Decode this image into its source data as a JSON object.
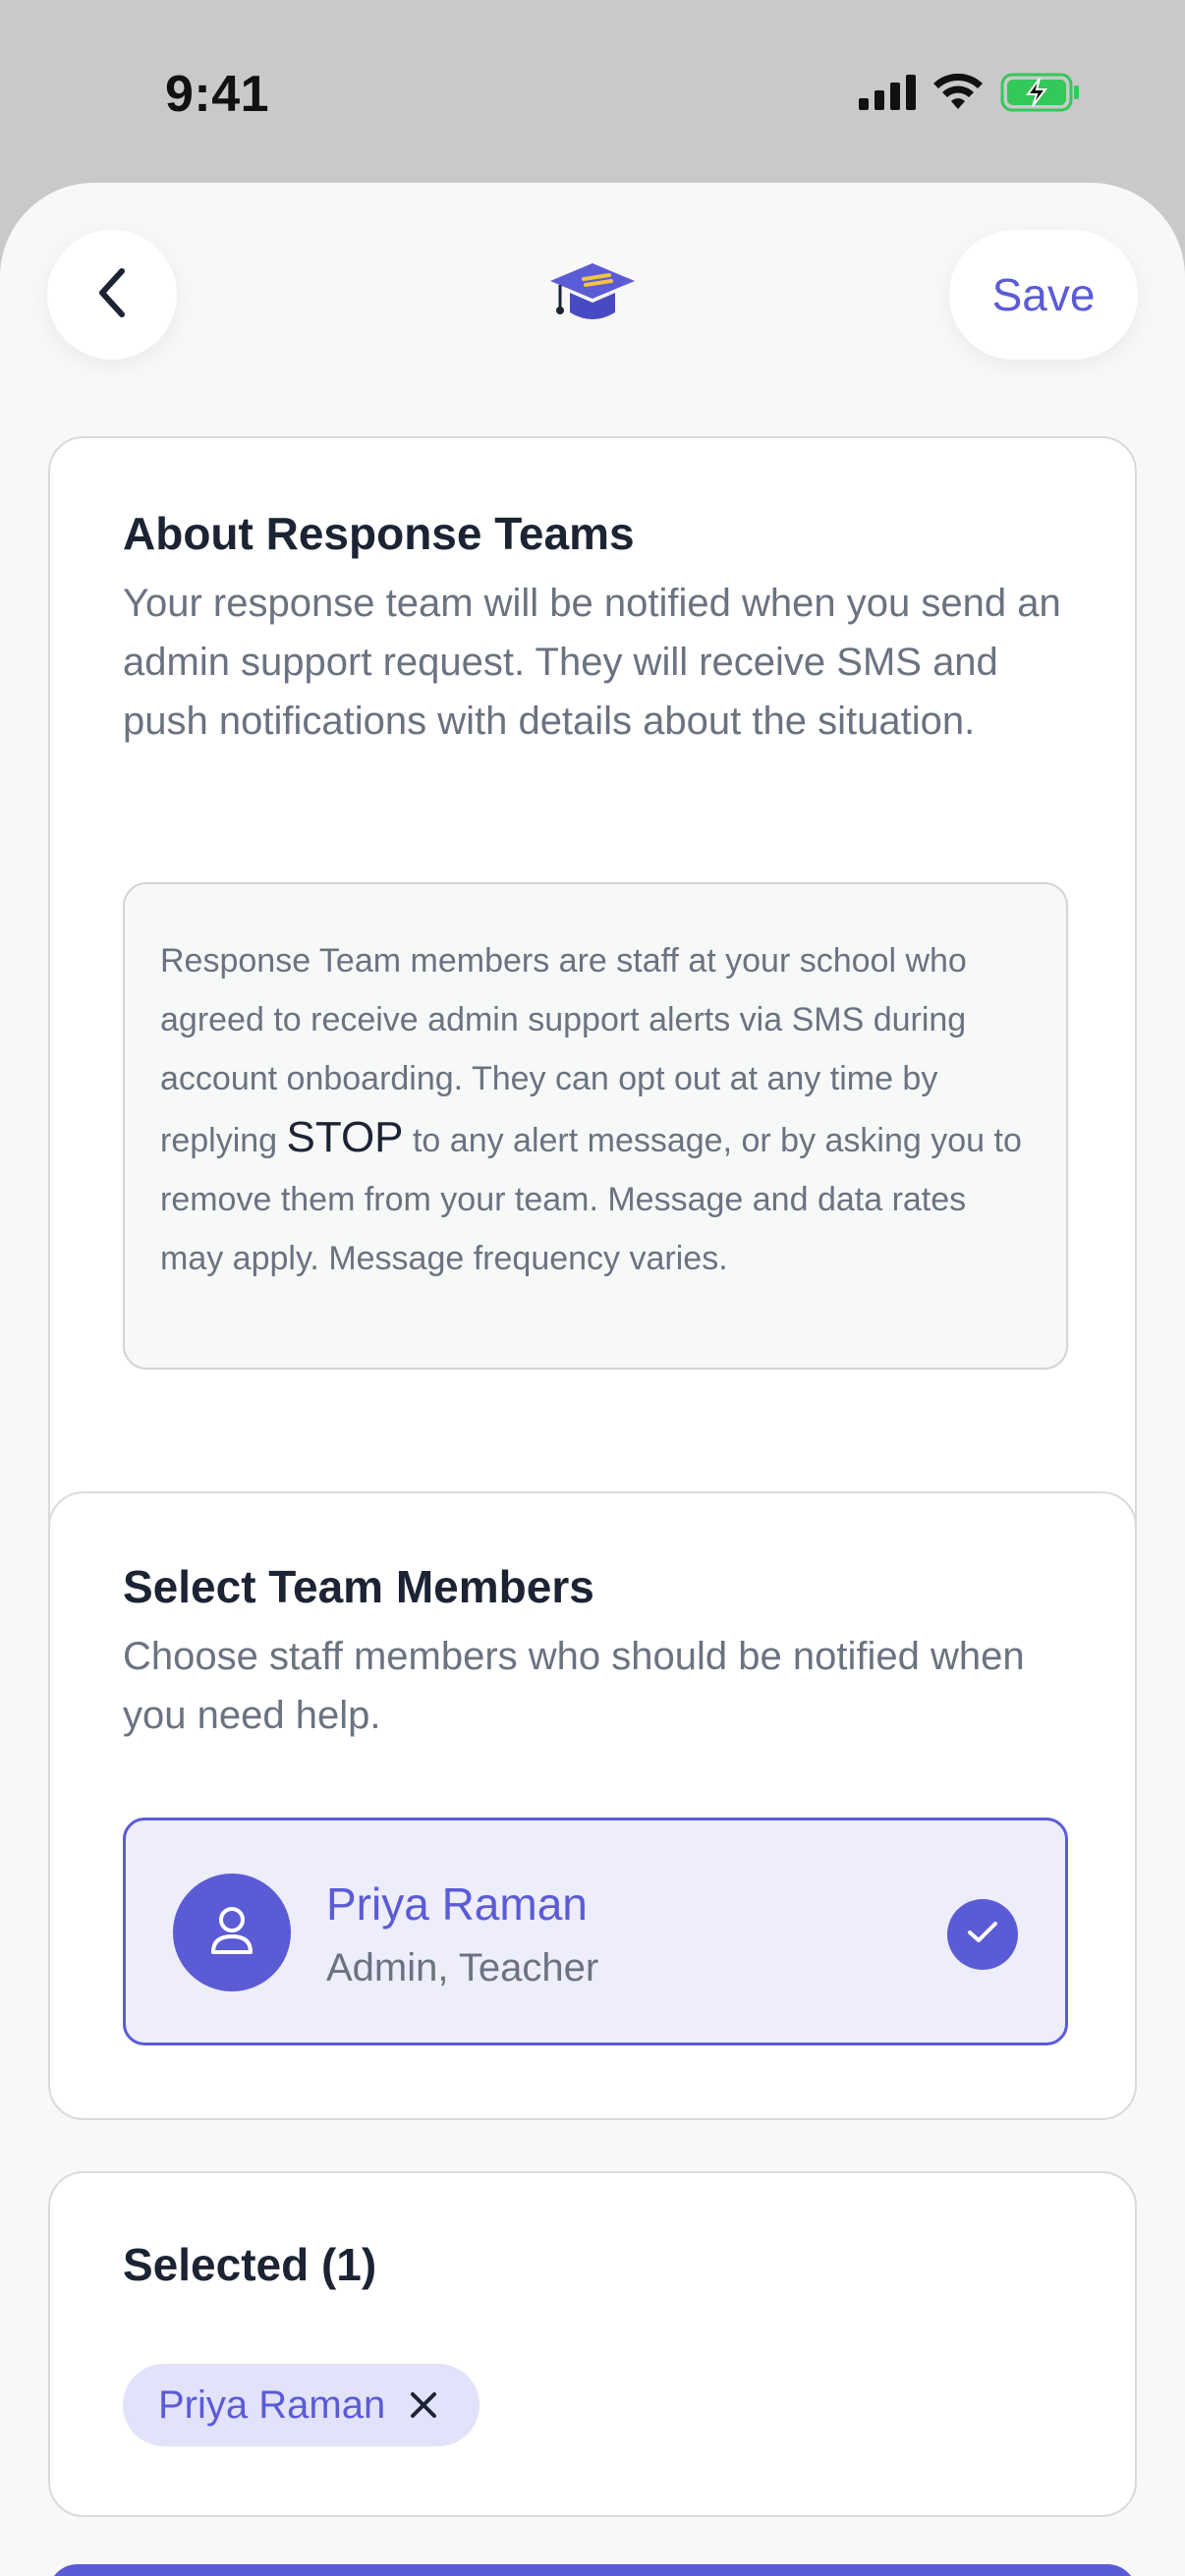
{
  "status_bar": {
    "time": "9:41"
  },
  "header": {
    "back_icon": "chevron-left-icon",
    "logo_icon": "graduation-cap-icon",
    "save_label": "Save"
  },
  "about": {
    "title": "About Response Teams",
    "description": "Your response team will be notified when you send an admin support request. They will receive SMS and push notifications with details about the situation.",
    "info_before": "Response Team members are staff at your school who agreed to receive admin support alerts via SMS during account onboarding. They can opt out at any time by replying ",
    "info_keyword": "STOP",
    "info_after": " to any alert message, or by asking you to remove them from your team. Message and data rates may apply. Message frequency varies."
  },
  "select_members": {
    "title": "Select Team Members",
    "description": "Choose staff members who should be notified when you need help.",
    "members": [
      {
        "name": "Priya Raman",
        "role": "Admin, Teacher",
        "selected": true
      }
    ]
  },
  "selected": {
    "title": "Selected (1)",
    "chips": [
      {
        "label": "Priya Raman"
      }
    ]
  },
  "colors": {
    "accent": "#5b5bd6",
    "accent_light": "#ededfb",
    "text_primary": "#1c2434",
    "text_secondary": "#6b7280",
    "battery_green": "#34c759"
  }
}
